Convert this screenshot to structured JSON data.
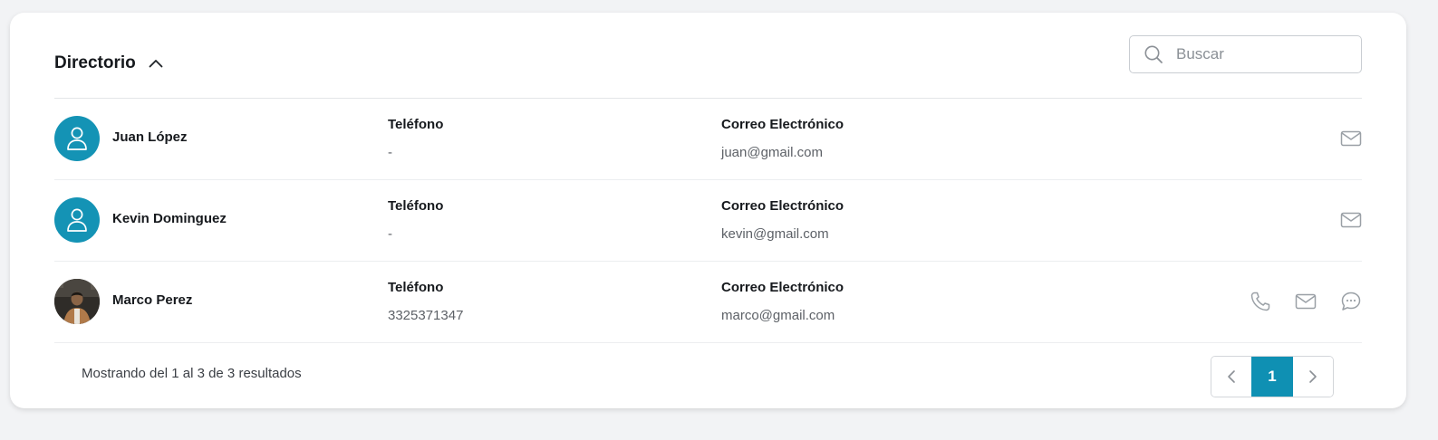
{
  "header": {
    "title": "Directorio",
    "search_placeholder": "Buscar"
  },
  "contacts": [
    {
      "name": "Juan López",
      "phone_label": "Teléfono",
      "phone": "-",
      "email_label": "Correo Electrónico",
      "email": "juan@gmail.com",
      "avatar": "default-user-icon",
      "actions": [
        "mail-icon"
      ]
    },
    {
      "name": "Kevin Dominguez",
      "phone_label": "Teléfono",
      "phone": "-",
      "email_label": "Correo Electrónico",
      "email": "kevin@gmail.com",
      "avatar": "default-user-icon",
      "actions": [
        "mail-icon"
      ]
    },
    {
      "name": "Marco Perez",
      "phone_label": "Teléfono",
      "phone": "3325371347",
      "email_label": "Correo Electrónico",
      "email": "marco@gmail.com",
      "avatar": "photo",
      "actions": [
        "phone-icon",
        "mail-icon",
        "chat-icon"
      ]
    }
  ],
  "footer": {
    "summary": "Mostrando del 1 al 3 de 3 resultados"
  },
  "pagination": {
    "current_page": "1"
  },
  "colors": {
    "accent": "#0f90b3",
    "avatar_bg": "#1493b5",
    "icon_gray": "#9aa0a6"
  }
}
